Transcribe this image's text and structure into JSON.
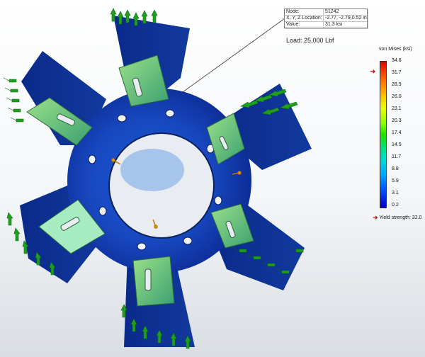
{
  "probe": {
    "rows": [
      {
        "key": "Node:",
        "value": "51242"
      },
      {
        "key": "X, Y, Z Location:",
        "value": "-2.77, -2.79,0.52 in"
      },
      {
        "key": "Value:",
        "value": "31.3   ksi"
      }
    ]
  },
  "load_label": "Load: 25,000 Lbf",
  "legend": {
    "title": "von Mises (ksi)",
    "ticks": [
      "34.6",
      "31.7",
      "28.9",
      "26.0",
      "23.1",
      "20.3",
      "17.4",
      "14.5",
      "11.7",
      "8.8",
      "5.9",
      "3.1",
      "0.2"
    ],
    "yield_marker_value": "31.7",
    "yield_label": "Yield strength: 32.0",
    "colors": {
      "max": "#e00000",
      "min": "#0000c8",
      "marker": "#c00000"
    }
  },
  "model": {
    "part_color": "#0a2c9a",
    "hub_color": "#1a4fc4",
    "bracket_color": "#5fbf6a",
    "fixture_icon": "fixture-arrows-icon",
    "load_icon": "load-arrow-icon"
  }
}
